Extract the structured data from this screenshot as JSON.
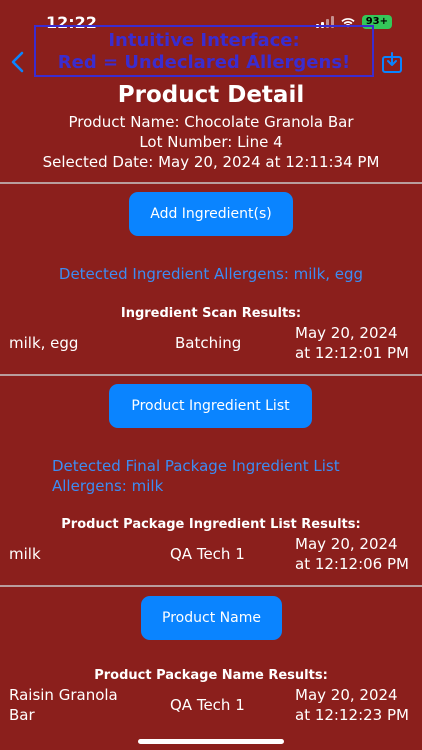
{
  "status": {
    "time": "12:22",
    "battery": "93+"
  },
  "banner": {
    "line1": "Intuitive Interface:",
    "line2": "Red = Undeclared Allergens!"
  },
  "page": {
    "title": "Product Detail",
    "product_name": "Product Name: Chocolate Granola Bar",
    "lot_number": "Lot Number: Line 4",
    "selected_date": "Selected Date: May 20, 2024 at 12:11:34 PM"
  },
  "ingredients": {
    "button_label": "Add Ingredient(s)",
    "detected": "Detected Ingredient Allergens: milk, egg",
    "results_title": "Ingredient Scan Results:",
    "row": {
      "allergens": "milk, egg",
      "stage": "Batching",
      "date": "May 20, 2024",
      "time": "at 12:12:01 PM"
    }
  },
  "package_list": {
    "button_label": "Product Ingredient List",
    "detected_line1": "Detected Final Package Ingredient List",
    "detected_line2": "Allergens: milk",
    "results_title": "Product Package Ingredient List Results:",
    "row": {
      "allergens": "milk",
      "stage": "QA Tech 1",
      "date": "May 20, 2024",
      "time": "at 12:12:06 PM"
    }
  },
  "package_name": {
    "button_label": "Product Name",
    "results_title": "Product Package Name Results:",
    "row": {
      "name_line1": "Raisin Granola",
      "name_line2": "Bar",
      "stage": "QA Tech 1",
      "date": "May 20, 2024",
      "time": "at 12:12:23 PM"
    }
  },
  "colors": {
    "background": "#8b1f1c",
    "button": "#0a84ff",
    "detected_text": "#3d8cf2",
    "banner": "#3b2ccf"
  },
  "icons": {
    "back": "chevron-left-icon",
    "share": "share-icon"
  }
}
